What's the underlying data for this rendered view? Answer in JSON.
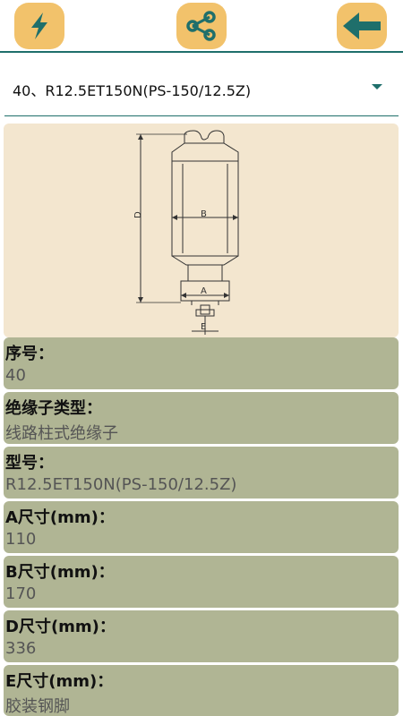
{
  "toolbar": {
    "left_icon": "lightning-icon",
    "center_icon": "share-icon",
    "right_icon": "arrow-left-icon",
    "button_color": "#f2c26b",
    "icon_color": "#1f6f6b"
  },
  "selector": {
    "value": "40、R12.5ET150N(PS-150/12.5Z)"
  },
  "diagram": {
    "labels": {
      "d": "D",
      "b": "B",
      "a": "A",
      "e": "E"
    }
  },
  "fields": [
    {
      "label": "序号：",
      "value": "40"
    },
    {
      "label": "绝缘子类型：",
      "value": "线路柱式绝缘子"
    },
    {
      "label": "型号：",
      "value": "R12.5ET150N(PS-150/12.5Z)"
    },
    {
      "label": "A尺寸(mm)：",
      "value": "110"
    },
    {
      "label": "B尺寸(mm)：",
      "value": "170"
    },
    {
      "label": "D尺寸(mm)：",
      "value": "336"
    },
    {
      "label": "E尺寸(mm)：",
      "value": "胶装钢脚"
    }
  ]
}
